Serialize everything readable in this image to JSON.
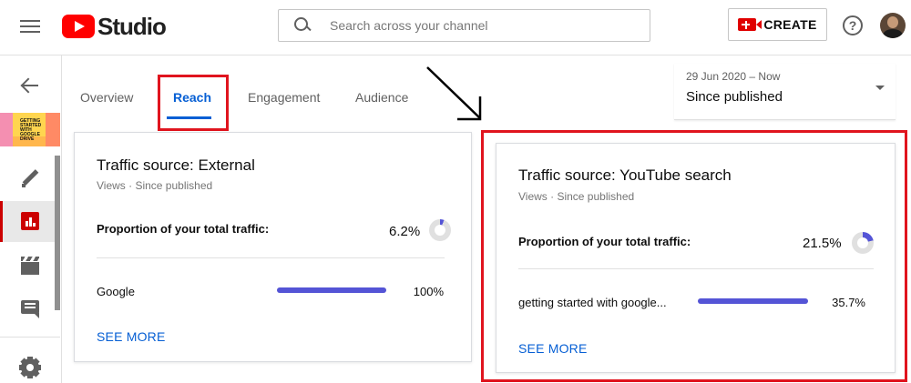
{
  "header": {
    "logo_text": "Studio",
    "search_placeholder": "Search across your channel",
    "create_label": "CREATE",
    "help_label": "?"
  },
  "sidebar": {
    "thumbnail_text": "GETTING STARTED WITH GOOGLE DRIVE"
  },
  "tabs": [
    {
      "label": "Overview",
      "active": false
    },
    {
      "label": "Reach",
      "active": true
    },
    {
      "label": "Engagement",
      "active": false
    },
    {
      "label": "Audience",
      "active": false
    }
  ],
  "date_selector": {
    "range": "29 Jun 2020 – Now",
    "label": "Since published"
  },
  "cards": [
    {
      "title": "Traffic source: External",
      "subtitle": "Views · Since published",
      "proportion_label": "Proportion of your total traffic:",
      "proportion_value": "6.2%",
      "proportion_fraction": 0.062,
      "rows": [
        {
          "label": "Google",
          "value": "100%",
          "fraction": 1.0
        }
      ],
      "see_more": "SEE MORE"
    },
    {
      "title": "Traffic source: YouTube search",
      "subtitle": "Views · Since published",
      "proportion_label": "Proportion of your total traffic:",
      "proportion_value": "21.5%",
      "proportion_fraction": 0.215,
      "rows": [
        {
          "label": "getting started with google...",
          "value": "35.7%",
          "fraction": 1.0
        }
      ],
      "see_more": "SEE MORE"
    }
  ],
  "colors": {
    "accent": "#065fd4",
    "bar": "#5454d6",
    "brand_red": "#ff0000",
    "highlight_red": "#e0141e"
  }
}
